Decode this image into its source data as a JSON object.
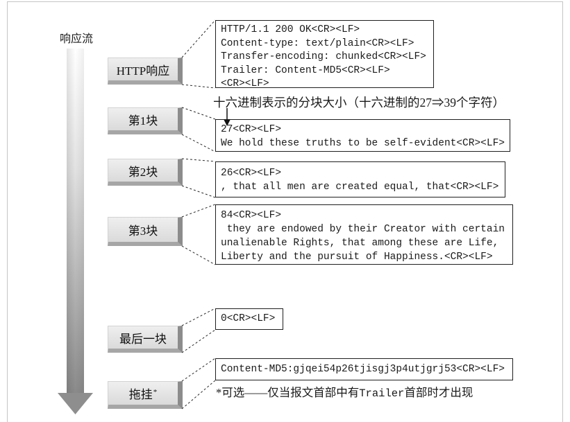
{
  "stream_label": "响应流",
  "segments": [
    {
      "label": "HTTP响应"
    },
    {
      "label": "第1块"
    },
    {
      "label": "第2块"
    },
    {
      "label": "第3块"
    },
    {
      "label": "最后一块"
    },
    {
      "label": "拖挂",
      "sup": "*"
    }
  ],
  "header_block": {
    "lines": [
      "HTTP/1.1 200 OK<CR><LF>",
      "Content-type: text/plain<CR><LF>",
      "Transfer-encoding: chunked<CR><LF>",
      "Trailer: Content-MD5<CR><LF>",
      "<CR><LF>"
    ]
  },
  "chunk_size_note": "十六进制表示的分块大小（十六进制的27⇒39个字符）",
  "chunks": [
    {
      "lines": [
        "27<CR><LF>",
        "We hold these truths to be self-evident<CR><LF>"
      ]
    },
    {
      "lines": [
        "26<CR><LF>",
        ", that all men are created equal, that<CR><LF>"
      ]
    },
    {
      "lines": [
        "84<CR><LF>",
        " they are endowed by their Creator with certain",
        "unalienable Rights, that among these are Life,",
        "Liberty and the pursuit of Happiness.<CR><LF>"
      ]
    }
  ],
  "last_chunk": {
    "lines": [
      "0<CR><LF>"
    ]
  },
  "trailer_block": {
    "lines": [
      "Content-MD5:gjqei54p26tjisgj3p4utjgrj53<CR><LF>"
    ]
  },
  "footnote": {
    "before": "*可选——仅当报文首部中有",
    "code": "Trailer",
    "after": "首部时才出现"
  },
  "colors": {
    "frame": "#c4c4c4",
    "segment_face": "#e4e4e4",
    "segment_shadow": "#8c8c8c",
    "arrow": "#8e8e8e",
    "ink": "#1a1a1a"
  }
}
